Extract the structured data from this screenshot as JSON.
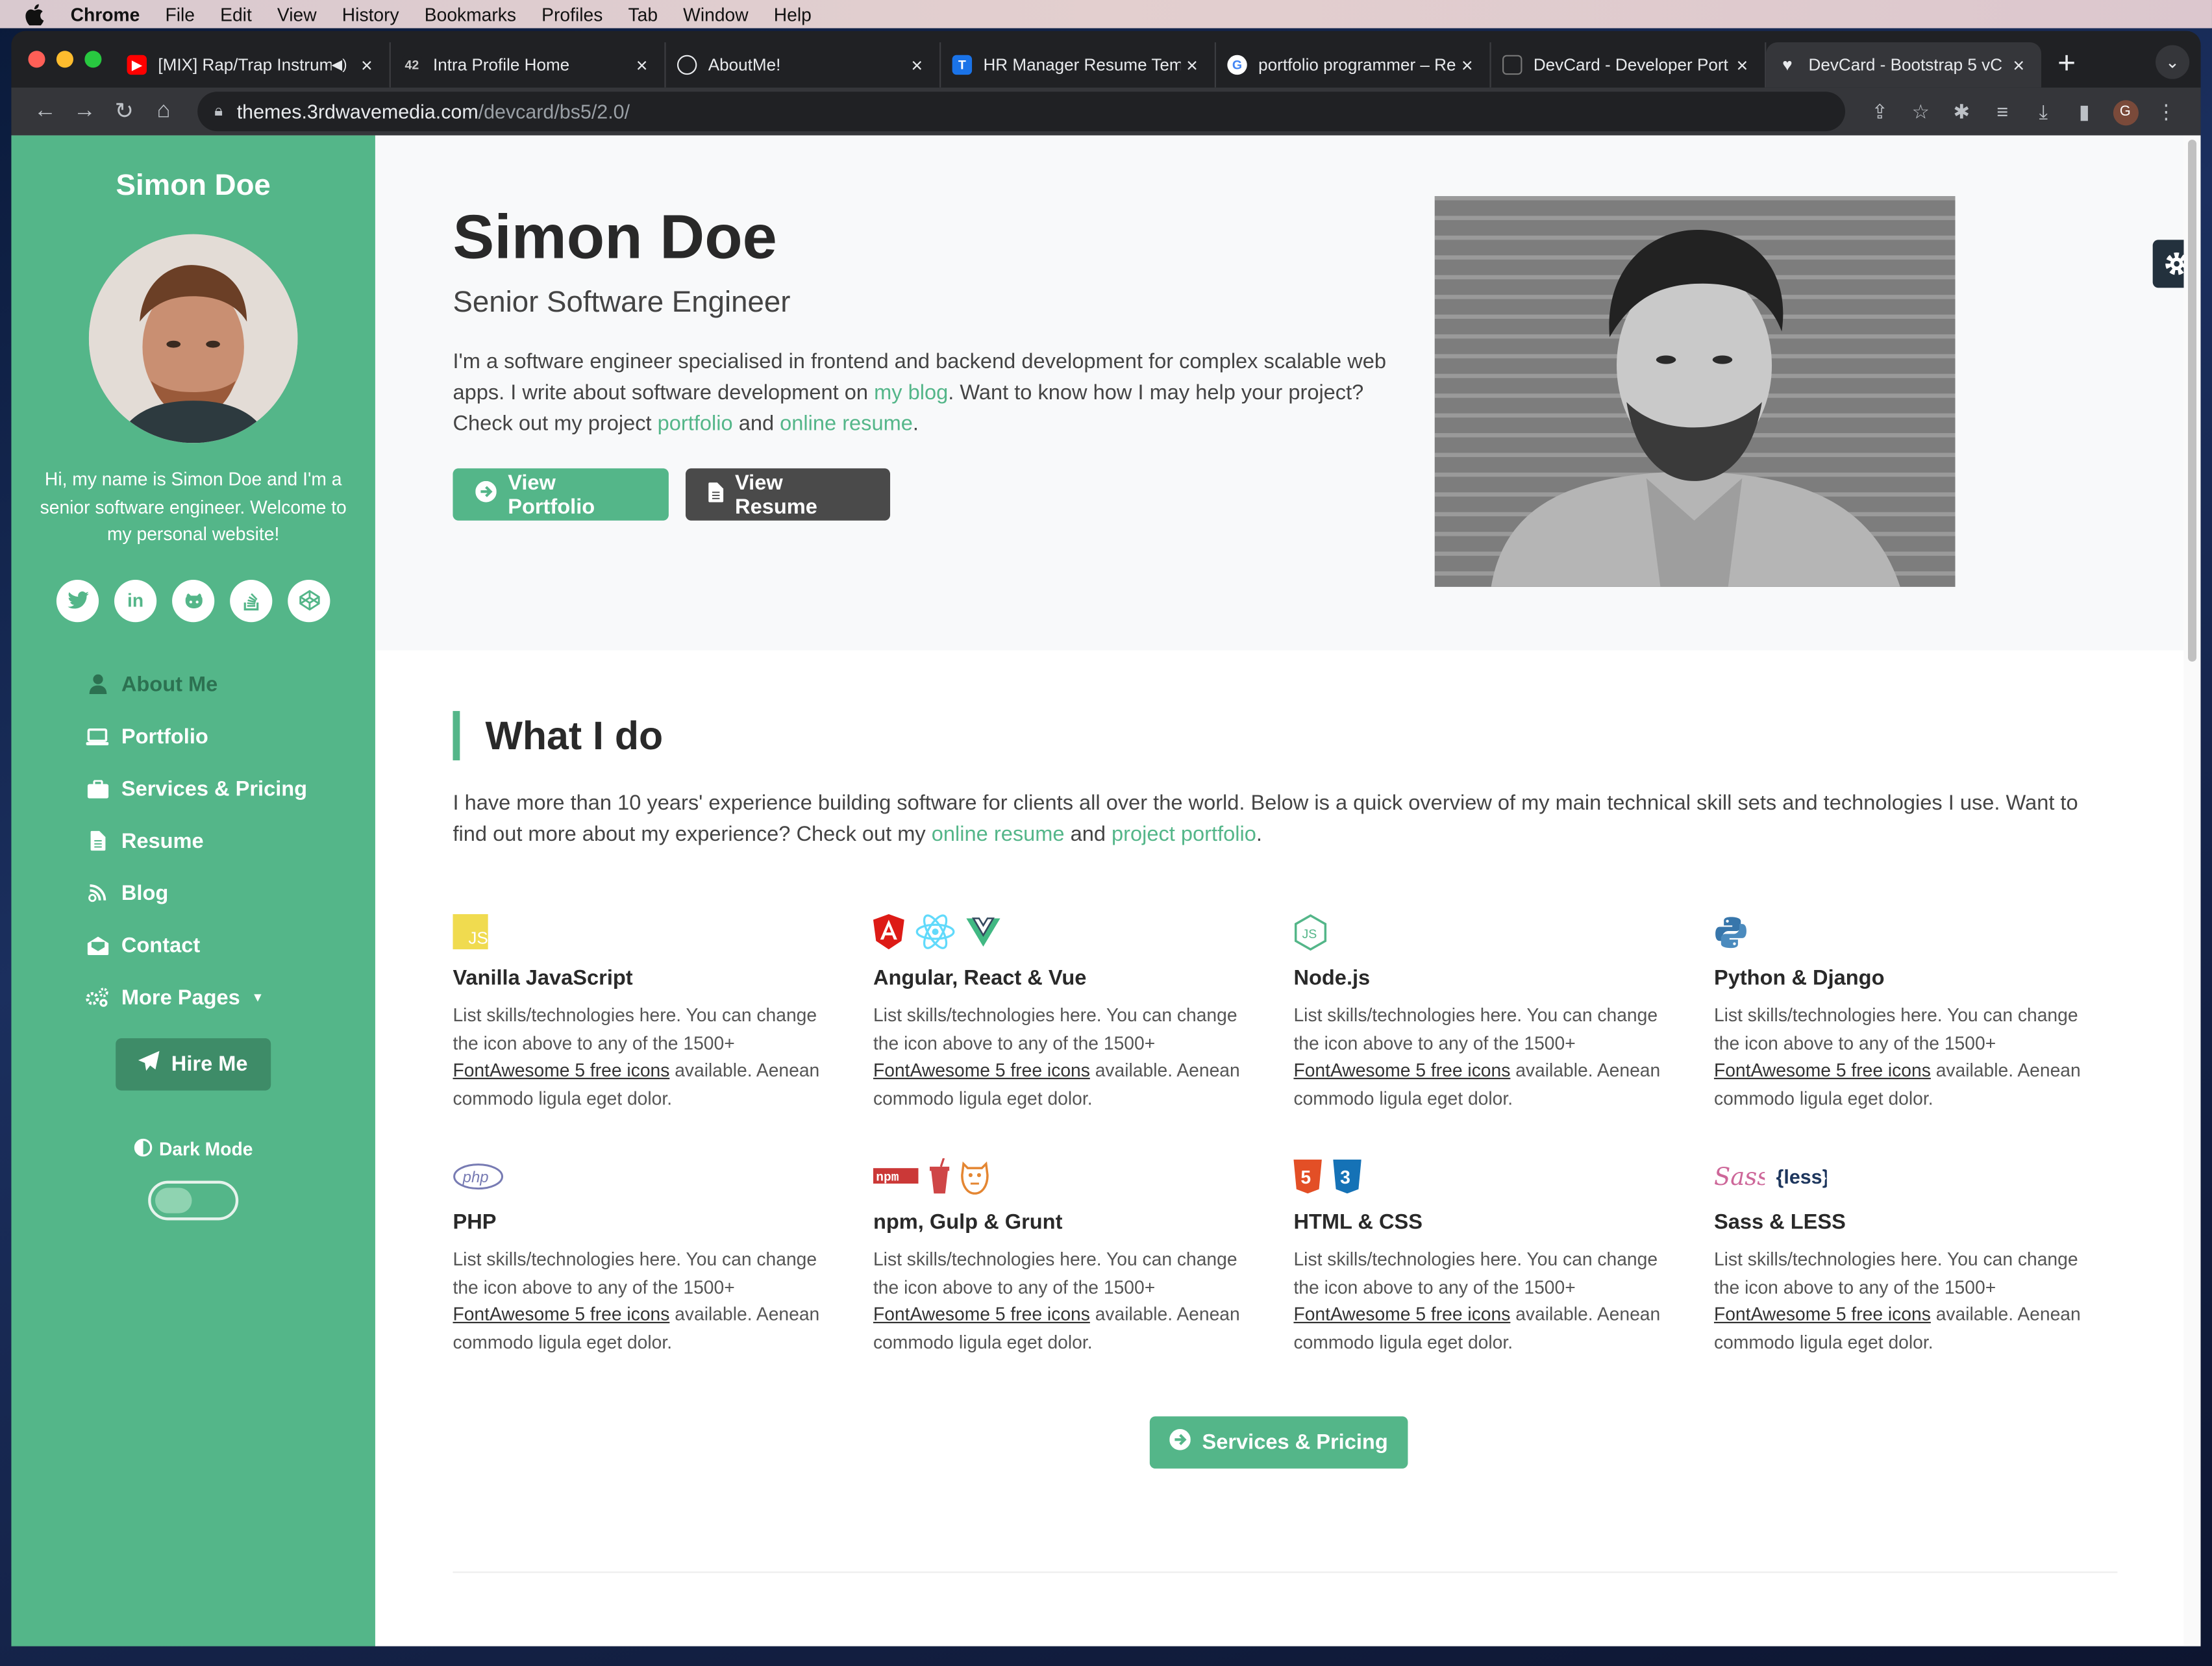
{
  "menubar": {
    "app": "Chrome",
    "items": [
      "File",
      "Edit",
      "View",
      "History",
      "Bookmarks",
      "Profiles",
      "Tab",
      "Window",
      "Help"
    ]
  },
  "browser": {
    "tabs": [
      {
        "title": "[MIX] Rap/Trap Instrum",
        "favicon_color": "#ff0000",
        "favicon": "youtube-icon"
      },
      {
        "title": "Intra Profile Home",
        "favicon_color": "#202124",
        "favicon": "42-icon"
      },
      {
        "title": "AboutMe!",
        "favicon_color": "#ffffff",
        "favicon": "globe-icon"
      },
      {
        "title": "HR Manager Resume Temp",
        "favicon_color": "#1a73e8",
        "favicon": "t-icon"
      },
      {
        "title": "portfolio programmer – Re",
        "favicon_color": "#ffffff",
        "favicon": "google-icon"
      },
      {
        "title": "DevCard - Developer Port",
        "favicon_color": "#202124",
        "favicon": "clipboard-icon"
      },
      {
        "title": "DevCard - Bootstrap 5 vC",
        "favicon_color": "#202124",
        "favicon": "heart-icon"
      }
    ],
    "url_host": "themes.3rdwavemedia.com",
    "url_path": "/devcard/bs5/2.0/"
  },
  "sidebar": {
    "name": "Simon Doe",
    "bio": "Hi, my name is Simon Doe and I'm a senior software engineer. Welcome to my personal website!",
    "socials": [
      "twitter-icon",
      "linkedin-icon",
      "github-icon",
      "stack-overflow-icon",
      "codepen-icon"
    ],
    "nav": [
      {
        "label": "About Me",
        "icon": "user-icon"
      },
      {
        "label": "Portfolio",
        "icon": "laptop-code-icon"
      },
      {
        "label": "Services & Pricing",
        "icon": "briefcase-icon"
      },
      {
        "label": "Resume",
        "icon": "file-alt-icon"
      },
      {
        "label": "Blog",
        "icon": "blog-icon"
      },
      {
        "label": "Contact",
        "icon": "envelope-open-icon"
      },
      {
        "label": "More Pages",
        "icon": "cogs-icon"
      }
    ],
    "hire_label": "Hire Me",
    "darkmode_label": "Dark Mode"
  },
  "hero": {
    "name": "Simon Doe",
    "title": "Senior Software Engineer",
    "desc_1": "I'm a software engineer specialised in frontend and backend development for complex scalable web apps. I write about software development on ",
    "link_blog": "my blog",
    "desc_2": ". Want to know how I may help your project? Check out my project ",
    "link_portfolio": "portfolio",
    "desc_3": " and ",
    "link_resume": "online resume",
    "desc_4": ".",
    "btn_portfolio": "View Portfolio",
    "btn_resume": "View Resume"
  },
  "whatido": {
    "title": "What I do",
    "desc_1": "I have more than 10 years' experience building software for clients all over the world. Below is a quick overview of my main technical skill sets and technologies I use. Want to find out more about my experience? Check out my ",
    "link_resume": "online resume",
    "desc_2": " and ",
    "link_portfolio": "project portfolio",
    "desc_3": ".",
    "skills": [
      {
        "title": "Vanilla JavaScript"
      },
      {
        "title": "Angular, React & Vue"
      },
      {
        "title": "Node.js"
      },
      {
        "title": "Python & Django"
      },
      {
        "title": "PHP"
      },
      {
        "title": "npm, Gulp & Grunt"
      },
      {
        "title": "HTML & CSS"
      },
      {
        "title": "Sass & LESS"
      }
    ],
    "skill_text_1": "List skills/technologies here. You can change the icon above to any of the 1500+ ",
    "skill_link": "FontAwesome 5 free icons",
    "skill_text_2": " available. Aenean commodo ligula eget dolor.",
    "btn_services": "Services & Pricing"
  }
}
